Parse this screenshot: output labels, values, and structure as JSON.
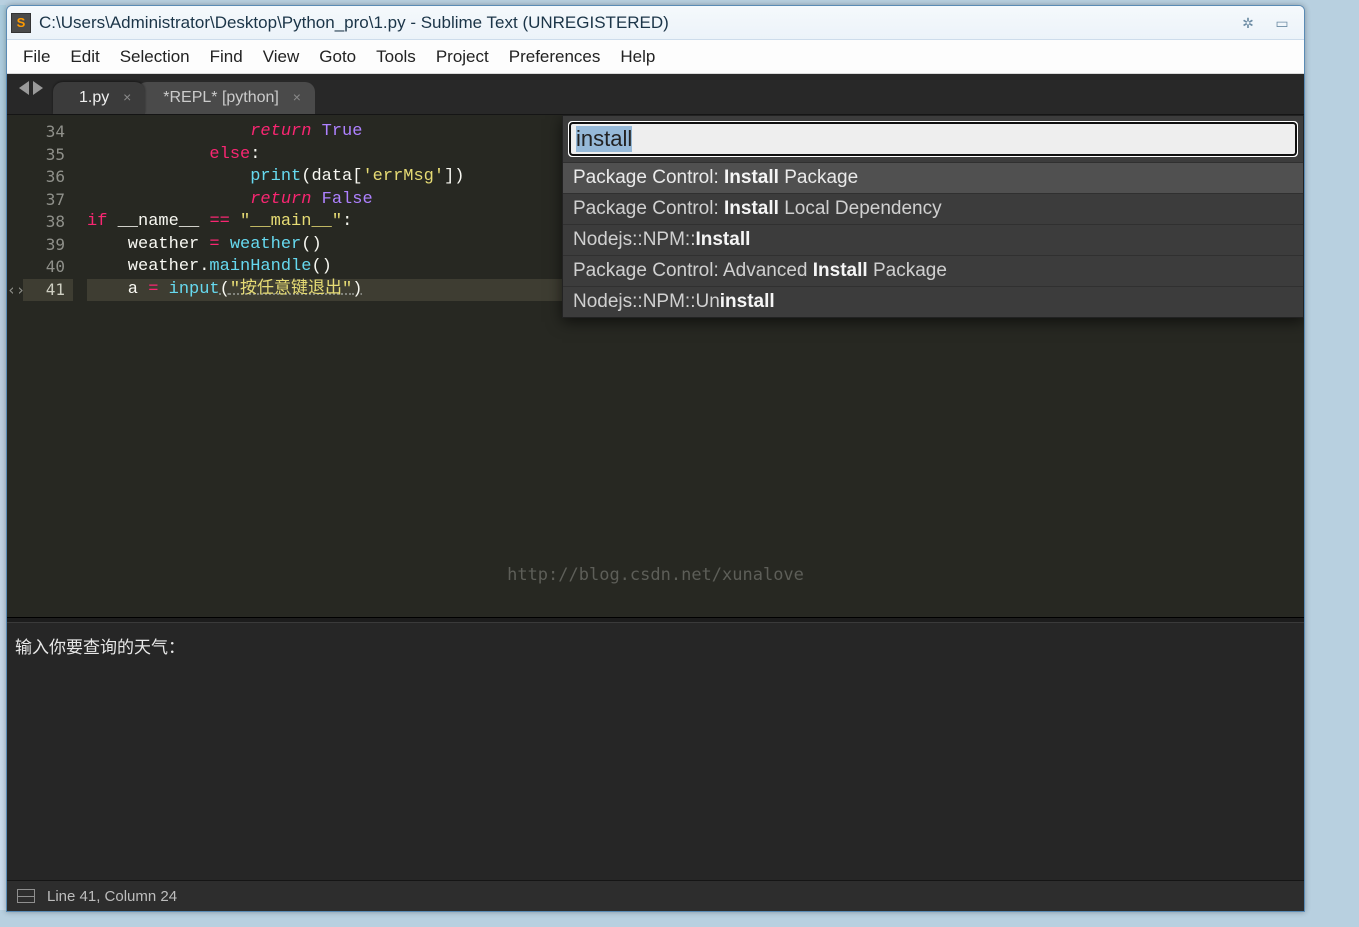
{
  "window": {
    "title": "C:\\Users\\Administrator\\Desktop\\Python_pro\\1.py - Sublime Text (UNREGISTERED)"
  },
  "menubar": [
    "File",
    "Edit",
    "Selection",
    "Find",
    "View",
    "Goto",
    "Tools",
    "Project",
    "Preferences",
    "Help"
  ],
  "tabs": [
    {
      "label": "1.py",
      "active": true
    },
    {
      "label": "*REPL* [python]",
      "active": false
    }
  ],
  "gutter": {
    "start": 34,
    "end": 41,
    "current": 41,
    "fold_marker_at": 41
  },
  "code_lines": [
    {
      "n": 34,
      "html": "                <span class='kw'>return</span> <span class='cst'>True</span>"
    },
    {
      "n": 35,
      "html": "            <span class='kw2'>else</span><span class='pun'>:</span>"
    },
    {
      "n": 36,
      "html": "                <span class='fn'>print</span><span class='pun'>(</span>data<span class='pun'>[</span><span class='str'>'errMsg'</span><span class='pun'>])</span>"
    },
    {
      "n": 37,
      "html": "                <span class='kw'>return</span> <span class='cst'>False</span>"
    },
    {
      "n": 38,
      "html": "<span class='kw2'>if</span> __name__ <span class='op'>==</span> <span class='str'>\"__main__\"</span><span class='pun'>:</span>"
    },
    {
      "n": 39,
      "html": "    weather <span class='op'>=</span> <span class='call'>weather</span><span class='pun'>()</span>"
    },
    {
      "n": 40,
      "html": "    weather<span class='pun'>.</span><span class='call'>mainHandle</span><span class='pun'>()</span>"
    },
    {
      "n": 41,
      "html": "    a <span class='op'>=</span> <span class='call'>input</span><span class='pun und'>(</span><span class='str und'>\"按任意键退出\"</span><span class='pun und'>)</span>"
    }
  ],
  "watermark": "http://blog.csdn.net/xunalove",
  "palette": {
    "query": "install",
    "results": [
      {
        "pre": "Package Control: ",
        "bold": "Install",
        "post": " Package",
        "selected": true
      },
      {
        "pre": "Package Control: ",
        "bold": "Install",
        "post": " Local Dependency",
        "selected": false
      },
      {
        "pre": "Nodejs::NPM::",
        "bold": "Install",
        "post": "",
        "selected": false
      },
      {
        "pre": "Package Control: Advanced ",
        "bold": "Install",
        "post": " Package",
        "selected": false
      },
      {
        "pre": "Nodejs::NPM::Un",
        "bold": "install",
        "post": "",
        "selected": false
      }
    ]
  },
  "output": "输入你要查询的天气：",
  "statusbar": {
    "position": "Line 41, Column 24"
  }
}
